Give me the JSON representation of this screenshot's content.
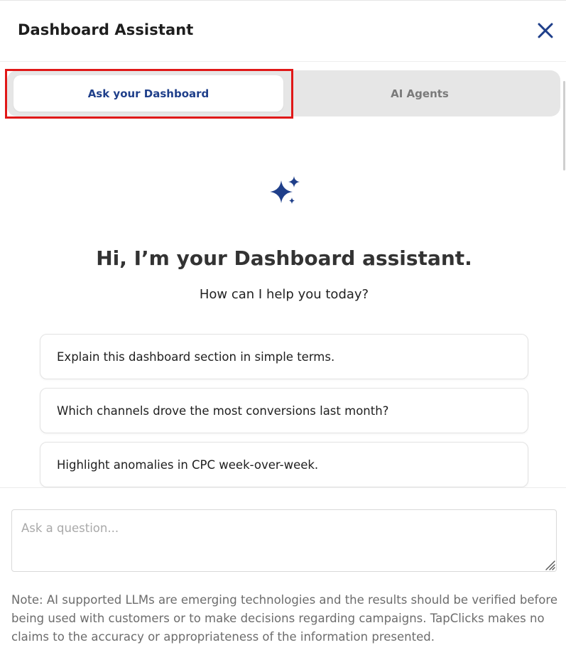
{
  "header": {
    "title": "Dashboard Assistant",
    "close_icon": "close-icon"
  },
  "tabs": [
    {
      "label": "Ask your Dashboard",
      "active": true
    },
    {
      "label": "AI Agents",
      "active": false
    }
  ],
  "hero": {
    "icon": "sparkle-icon",
    "greeting": "Hi, I’m your Dashboard assistant.",
    "subtitle": "How can I help you today?"
  },
  "suggestions": [
    "Explain this dashboard section in simple terms.",
    "Which channels drove the most conversions last month?",
    "Highlight anomalies in CPC week-over-week."
  ],
  "input": {
    "placeholder": "Ask a question...",
    "value": ""
  },
  "note": "Note: AI supported LLMs are emerging technologies and the results should be verified before being used with customers or to make decisions regarding campaigns. TapClicks makes no claims to the accuracy or appropriateness of the information presented.",
  "colors": {
    "accent": "#1f3f8a",
    "highlight": "#e01818",
    "tab_bg": "#e6e6e6",
    "note_text": "#6c6c6c"
  }
}
